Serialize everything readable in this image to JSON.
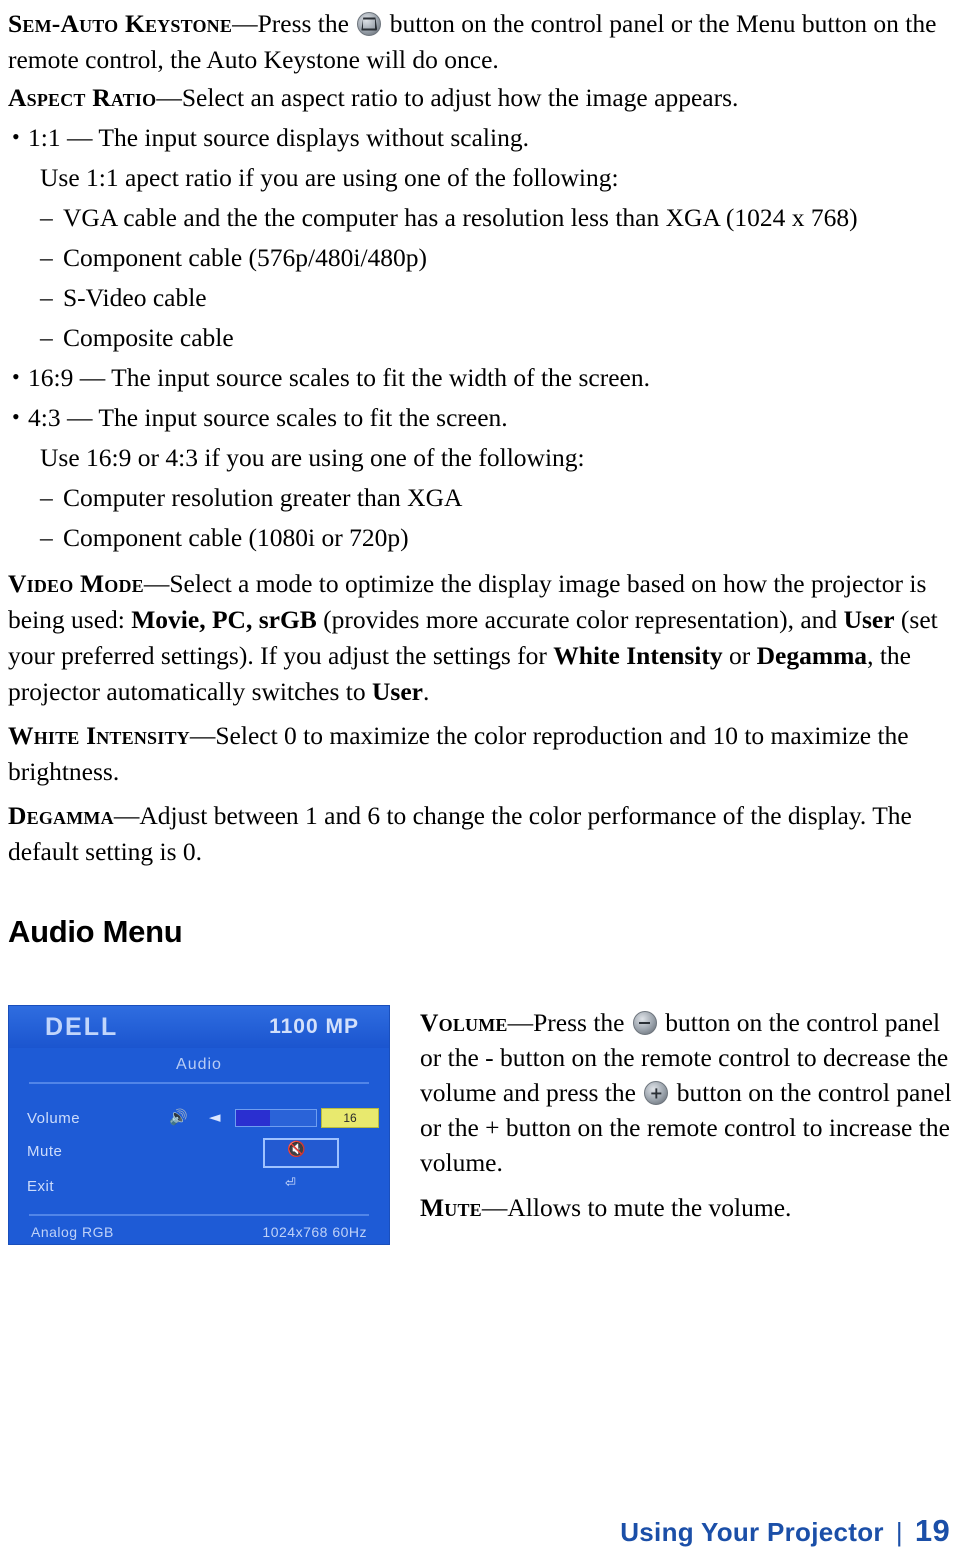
{
  "body": {
    "semi_auto_keystone": {
      "term": "Sem-Auto Keystone",
      "text_before_icon": "—Press the ",
      "icon": "keystone-button-icon",
      "text_after_icon": " button on the control panel or the Menu button on the remote control, the Auto Keystone will do once."
    },
    "aspect_ratio": {
      "term": "Aspect Ratio",
      "text": "—Select an aspect ratio to adjust how the image appears."
    },
    "aspect_items": [
      {
        "marker": "bullet",
        "text": "1:1 — The input source displays without scaling."
      },
      {
        "marker": "none",
        "text": "Use 1:1 apect ratio if you are using one of the following:"
      },
      {
        "marker": "dash",
        "text": "VGA cable and the the computer has a resolution less than XGA (1024 x 768)"
      },
      {
        "marker": "dash",
        "text": "Component cable (576p/480i/480p)"
      },
      {
        "marker": "dash",
        "text": "S-Video cable"
      },
      {
        "marker": "dash",
        "text": "Composite cable"
      },
      {
        "marker": "bullet",
        "text": "16:9 — The input source scales to fit the width of the screen."
      },
      {
        "marker": "bullet",
        "text": "4:3 — The input source scales to fit the screen."
      },
      {
        "marker": "none",
        "text": "Use 16:9 or 4:3 if you are using one of the following:"
      },
      {
        "marker": "dash",
        "text": "Computer resolution greater than XGA"
      },
      {
        "marker": "dash",
        "text": "Component cable (1080i or 720p)"
      }
    ],
    "video_mode": {
      "term": "Video Mode",
      "p1": "—Select a mode to optimize the display image based on how the projector is being used: ",
      "b1": "Movie, PC, srGB",
      "p2": " (provides more accurate color representation), and ",
      "b2": "User",
      "p3": " (set your preferred settings). If you adjust the settings for ",
      "b3": "White Intensity",
      "p4": " or ",
      "b4": "Degamma",
      "p5": ", the projector automatically switches to ",
      "b5": "User",
      "p6": "."
    },
    "white_intensity": {
      "term": "White Intensity",
      "text": "—Select 0 to maximize the color reproduction and 10 to maximize the brightness."
    },
    "degamma": {
      "term": "Degamma",
      "text": "—Adjust between 1 and 6 to change the color performance of the display. The default setting is 0."
    },
    "audio_heading": "Audio Menu",
    "volume": {
      "term": "Volume",
      "t1": "—Press the ",
      "icon1": "minus-button-icon",
      "t2": " button on the control panel or the - button on the remote control to decrease the volume and press the ",
      "icon2": "plus-button-icon",
      "t3": " button on the control panel or the + button on the remote control to increase the volume."
    },
    "mute": {
      "term": "Mute",
      "text": "—Allows to mute the volume."
    }
  },
  "osd": {
    "brand": "DELL",
    "model": "1100 MP",
    "title": "Audio",
    "rows": [
      {
        "label": "Volume",
        "icon": "speaker-icon",
        "value": "16"
      },
      {
        "label": "Mute",
        "icon": "mute-speaker-icon",
        "value": ""
      },
      {
        "label": "Exit",
        "icon": "exit-icon",
        "value": ""
      }
    ],
    "footer_left": "Analog RGB",
    "footer_right": "1024x768 60Hz",
    "colors": {
      "background": "#1e5bd6",
      "highlight": "#e8e96e",
      "selection": "#9fc2ff"
    }
  },
  "footer": {
    "section": "Using Your Projector",
    "separator": "|",
    "page": "19"
  }
}
